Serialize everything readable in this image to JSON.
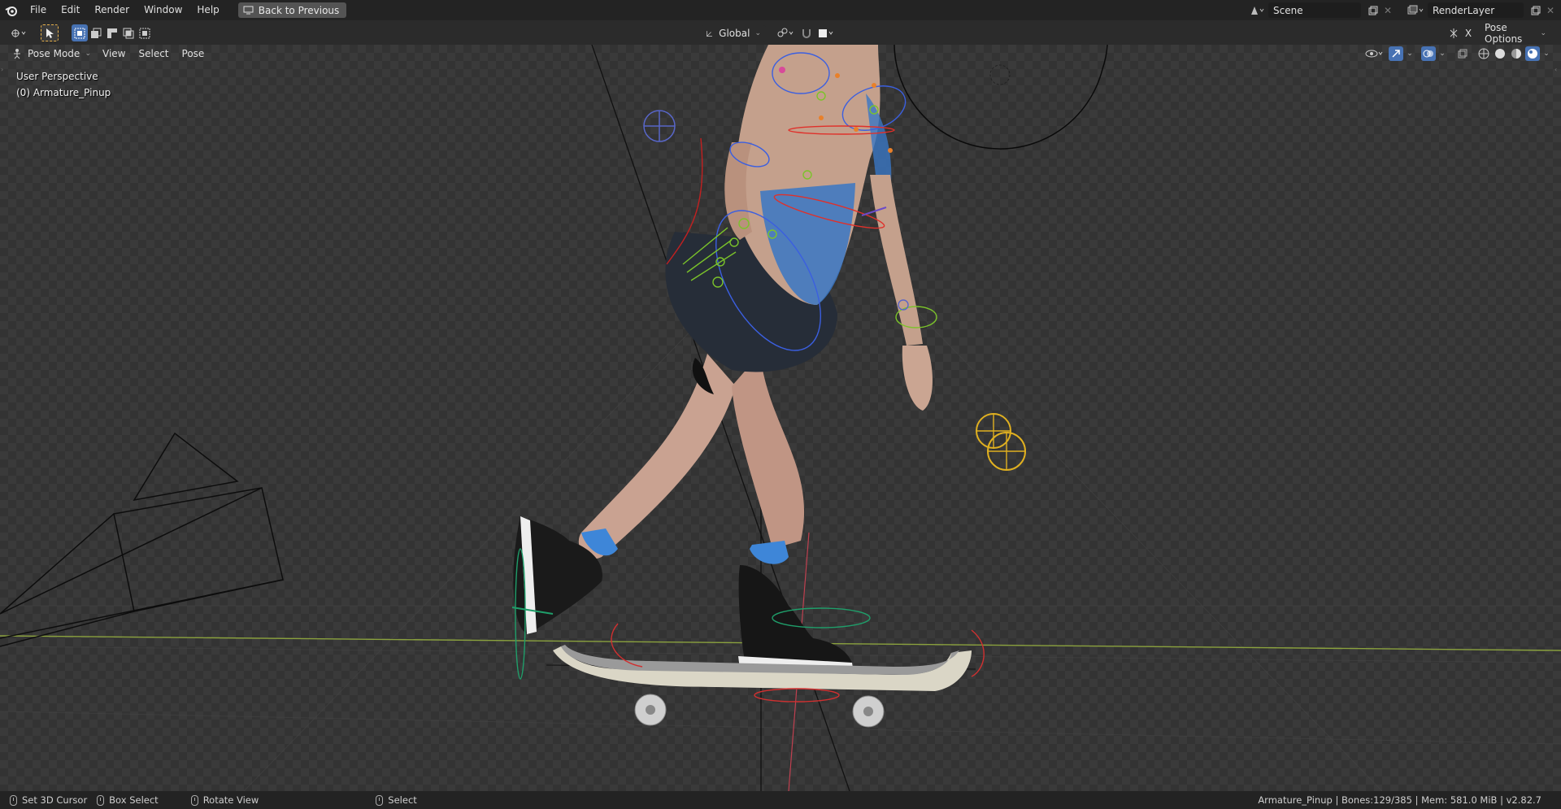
{
  "menu": {
    "items": [
      "File",
      "Edit",
      "Render",
      "Window",
      "Help"
    ],
    "back_button": "Back to Previous"
  },
  "scene": {
    "name": "Scene"
  },
  "render_layer": {
    "name": "RenderLayer"
  },
  "tool_header": {
    "orientation": "Global",
    "pose_options": "Pose Options",
    "x_mirror": "X"
  },
  "viewport_header": {
    "mode": "Pose Mode",
    "menus": [
      "View",
      "Select",
      "Pose"
    ]
  },
  "overlay": {
    "perspective": "User Perspective",
    "object": "(0) Armature_Pinup"
  },
  "statusbar": {
    "left_action": "Set 3D Cursor",
    "middle_action": "Box Select",
    "right_action": "Rotate View",
    "select_action": "Select",
    "info": "Armature_Pinup | Bones:129/385 | Mem: 581.0 MiB | v2.82.7"
  },
  "colors": {
    "accent": "#4772b3",
    "topbar": "#232323",
    "header": "#2b2b2b"
  }
}
